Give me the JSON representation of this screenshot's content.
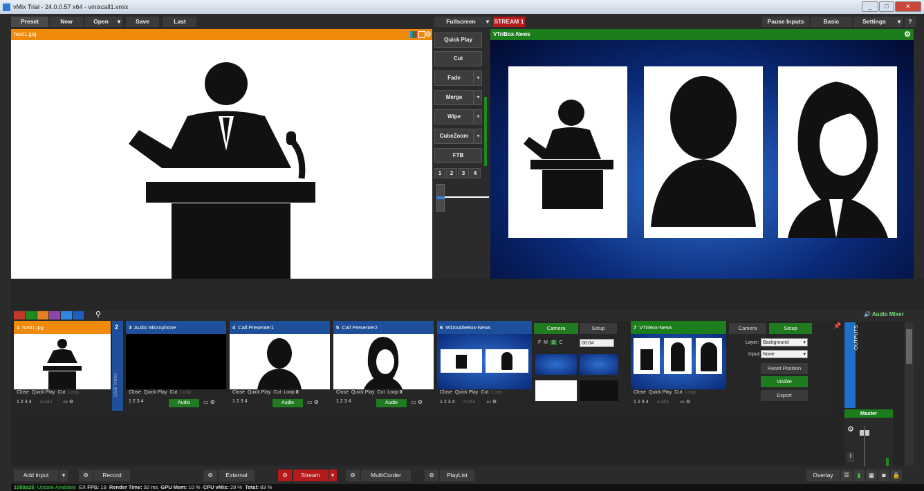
{
  "window": {
    "title": "vMix Trial - 24.0.0.57 x64 - vmixcall1.vmix",
    "controls": [
      "_",
      "□",
      "✕"
    ]
  },
  "topbar": {
    "preset": "Preset",
    "new": "New",
    "open": "Open",
    "save": "Save",
    "last": "Last",
    "fullscreen": "Fullscreen",
    "stream": "STREAM 1",
    "pause_inputs": "Pause Inputs",
    "basic": "Basic",
    "settings": "Settings",
    "help": "?"
  },
  "preview": {
    "title": "host1.jpg"
  },
  "program": {
    "title": "VTriBox-News"
  },
  "transitions": {
    "buttons": [
      "Quick Play",
      "Cut",
      "Fade",
      "Merge",
      "Wipe",
      "CubeZoom",
      "FTB"
    ],
    "numbers": [
      "1",
      "2",
      "3",
      "4"
    ]
  },
  "colors": {
    "accent_orange": "#ef8a0a",
    "program_green": "#1c7d1c",
    "input_blue": "#1d4f9a",
    "stream_red": "#b51b1b",
    "swatches": [
      "#c0392b",
      "#1f8a1f",
      "#e67e22",
      "#8e44ad",
      "#2e86de",
      "#1f5fbf"
    ]
  },
  "audio_mixer": {
    "label": "Audio Mixer",
    "outputs": "OUTPUTS",
    "master": "Master"
  },
  "inputs": [
    {
      "num": "1",
      "title": "host1.jpg",
      "close": "Close",
      "quick_play": "Quick Play",
      "cut": "Cut",
      "loop": "Loop",
      "nums": [
        "1",
        "2",
        "3",
        "4"
      ],
      "audio": "Audio"
    },
    {
      "num": "2",
      "title": "",
      "side": "USB Video"
    },
    {
      "num": "3",
      "title": "Audio Microphone",
      "close": "Close",
      "quick_play": "Quick Play",
      "cut": "Cut",
      "loop": "Loop",
      "nums": [
        "1",
        "2",
        "3",
        "4"
      ],
      "audio": "Audio"
    },
    {
      "num": "4",
      "title": "Call Presenter1",
      "close": "Close",
      "quick_play": "Quick Play",
      "cut": "Cut",
      "loop": "Loop",
      "nums": [
        "1",
        "2",
        "3",
        "4"
      ],
      "audio": "Audio"
    },
    {
      "num": "5",
      "title": "Call Presenter2",
      "close": "Close",
      "quick_play": "Quick Play",
      "cut": "Cut",
      "loop": "Loop",
      "nums": [
        "1",
        "2",
        "3",
        "4"
      ],
      "audio": "Audio"
    },
    {
      "num": "6",
      "title": "WDoubleBox-News",
      "close": "Close",
      "quick_play": "Quick Play",
      "cut": "Cut",
      "loop": "Loop",
      "nums": [
        "1",
        "2",
        "3",
        "4"
      ],
      "audio": "Audio"
    },
    {
      "num": "7",
      "title": "VTriBox-News",
      "close": "Close",
      "quick_play": "Quick Play",
      "cut": "Cut",
      "loop": "Loop",
      "nums": [
        "1",
        "2",
        "3",
        "4"
      ],
      "audio": "Audio"
    }
  ],
  "camera_panel": {
    "camera": "Camera",
    "setup": "Setup",
    "f": "F",
    "m": "M",
    "s": "S",
    "c": "C",
    "time": "00:04"
  },
  "camera_panel2": {
    "camera": "Camera",
    "setup": "Setup",
    "layer_label": "Layer:",
    "layer_value": "Background",
    "input_label": "Input:",
    "input_value": "None",
    "reset": "Reset Position",
    "visible": "Visible",
    "export": "Export"
  },
  "bottom": {
    "add_input": "Add Input",
    "record": "Record",
    "external": "External",
    "stream": "Stream",
    "multicorder": "MultiCorder",
    "playlist": "PlayList",
    "overlay": "Overlay"
  },
  "status": {
    "res": "1080p25",
    "update": "Update Available",
    "ex": "EX",
    "fps_label": "FPS:",
    "fps": "19",
    "render_label": "Render Time:",
    "render": "92 ms",
    "gpu_label": "GPU Mem:",
    "gpu": "10 %",
    "cpu_label": "CPU vMix:",
    "cpu": "29 %",
    "total_label": "Total:",
    "total": "83 %"
  }
}
